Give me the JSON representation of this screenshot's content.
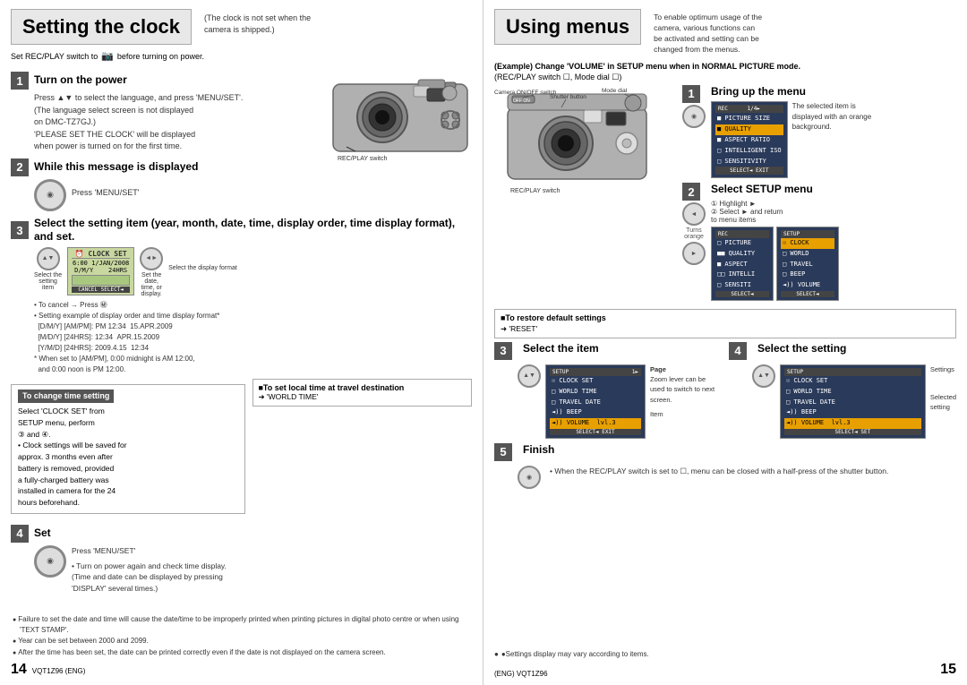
{
  "left": {
    "title": "Setting the clock",
    "header_note": "(The clock is not set when the\ncamera is shipped.)",
    "subtitle_line": "Set REC/PLAY switch to",
    "subtitle_line2": "before turning on power.",
    "steps": [
      {
        "num": "1",
        "title": "Turn on the power",
        "content": "Press ▲▼ to select the language, and press 'MENU/SET'.\n(The language select screen is not displayed\non DMC-TZ7GJ.)\n'PLEASE SET THE CLOCK' will be displayed\nwhen power is turned on for the first time."
      },
      {
        "num": "2",
        "title": "While this message is displayed",
        "content": "Press 'MENU/SET'"
      },
      {
        "num": "3",
        "title": "Select the setting item (year, month, date, time, display order, time display format), and set.",
        "content_select": "Select the\nsetting\nitem",
        "content_set": "Set the\ndate,\ntime, or\ndisplay.",
        "content_format": "Select the display format",
        "cancel_note": "• To cancel → Press ㊙",
        "example_note": "• Setting example of display order and time display format*\n[D/M/Y] [AM/PM]: PM 12:34  15.APR.2009\n[M/D/Y] [24HRS]: 12:34  APR.15.2009\n[Y/M/D] [24HRS]: 2009.4.15  12:34\n* When set to [AM/PM], 0:00 midnight is AM 12:00,\nand 0:00 noon is PM 12:00."
      },
      {
        "num": "4",
        "title": "Set",
        "content": "Press 'MENU/SET'\n\n• Turn on power again and check time display.\n(Time and date can be displayed by pressing\n'DISPLAY' several times.)"
      }
    ],
    "change_time_box": {
      "title": "To change time setting",
      "content": "Select 'CLOCK SET' from\nSETUP menu, perform\n③ and ④.\n• Clock settings will be saved for\napprox. 3 months even after\nbattery is removed, provided\na fully-charged battery was\ninstalled in camera for the 24\nhours beforehand."
    },
    "travel_box": {
      "title": "■To set local time at travel\ndestination",
      "content": "➜ 'WORLD TIME'"
    },
    "footer_notes": [
      "Failure to set the date and time will cause the date/time to be improperly printed when printing\npictures in digital photo centre or when using 'TEXT STAMP'.",
      "Year can be set between 2000 and 2099.",
      "After the time has been set, the date can be printed correctly even if the date is not displayed on the camera screen."
    ],
    "page_number": "14",
    "vqt": "VQT1Z96 (ENG)"
  },
  "right": {
    "title": "Using menus",
    "header_note": "To enable optimum usage of the\ncamera, various functions can\nbe activated and setting can be\nchanged from the menus.",
    "example_line1": "(Example) Change 'VOLUME' in SETUP menu when in NORMAL PICTURE mode.",
    "example_line2": "(REC/PLAY switch ☐, Mode dial ☐)",
    "cam_labels": {
      "on_off": "Camera ON/OFF switch",
      "shutter": "Shutter button",
      "mode": "Mode dial",
      "recplay": "REC/PLAY switch"
    },
    "steps": [
      {
        "num": "1",
        "title": "Bring up the menu",
        "note": "The selected item is displayed with an orange background."
      },
      {
        "num": "2",
        "title": "Select SETUP menu",
        "sub1": "① Highlight ►",
        "sub2": "② Select ► and return\nto menu items",
        "turns_orange": "Turns\norange"
      },
      {
        "num": "3",
        "title": "Select the item",
        "page_note": "Page\n(Zoom lever can\nbe used to switch\nto next screen.)",
        "item_note": "Item"
      },
      {
        "num": "4",
        "title": "Select the setting",
        "settings_note": "Settings",
        "selected_note": "Selected\nsetting"
      },
      {
        "num": "5",
        "title": "Finish",
        "content": "• When the REC/PLAY switch is set\nto ☐, menu can be closed with a\nhalf-press of the shutter button."
      }
    ],
    "restore_box": {
      "title": "■To restore default settings",
      "content": "➜ 'RESET'"
    },
    "footer_note": "●Settings display may vary according to items.",
    "page_number": "15",
    "vqt": "(ENG) VQT1Z96"
  },
  "menu_screens": {
    "rec_menu": [
      "■ PICTURE SIZE",
      "■ QUALITY",
      "■ ASPECT RATIO",
      "□ INTELLIGENT ISO",
      "□ SENSITIVITY"
    ],
    "setup_menu_left": [
      "□ PICTURE",
      "■■ QUALITY",
      "■ ASPECT",
      "□□ INTELLI",
      "□ SENSITI"
    ],
    "setup_menu_right": [
      "☉ CLOCK",
      "□ WORLD",
      "□ TRAVEL",
      "□ BEEP",
      "◄)) VOLUME"
    ],
    "setup_item": [
      "☉ CLOCK SET",
      "□ WORLD TIME",
      "□ TRAVEL DATE",
      "◄)) BEEP",
      "◄)) VOLUME"
    ],
    "setup_setting": [
      "☉ CLOCK SET",
      "□ WORLD TIME",
      "□ TRAVEL DATE",
      "◄)) BEEP",
      "◄)) VOLUME   lvl.3"
    ],
    "clock_set_screen": [
      "6:00  1/JAN/2008",
      "D/M/Y     24HRS",
      "",
      "CANCEL  SELECT◄"
    ]
  }
}
